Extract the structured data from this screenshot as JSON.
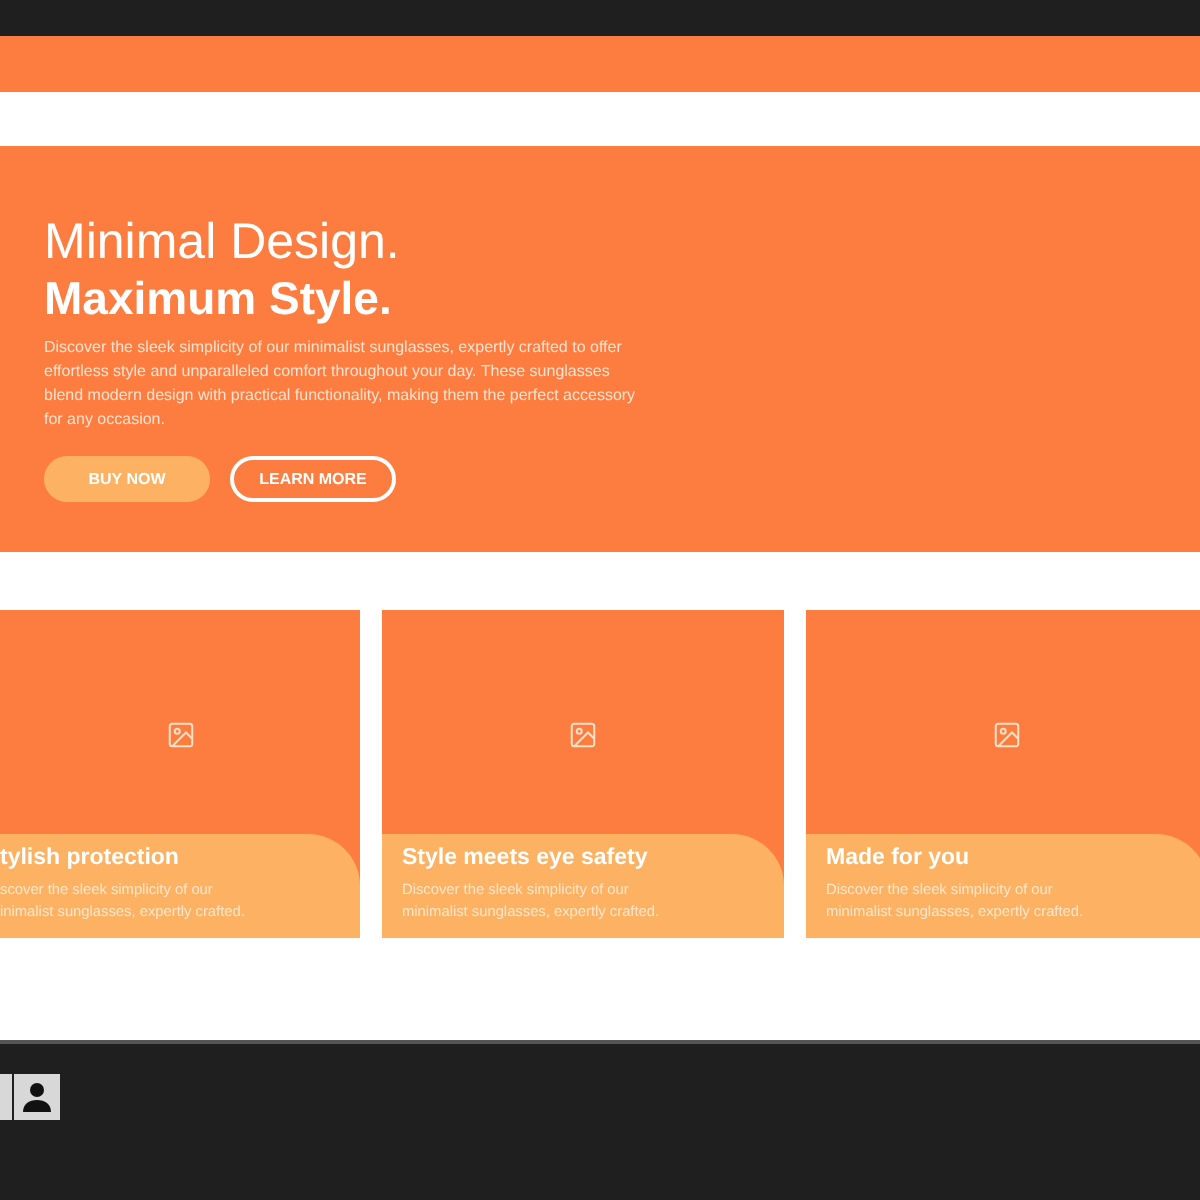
{
  "hero": {
    "title": "Minimal Design.",
    "subtitle": "Maximum Style.",
    "text": "Discover the sleek simplicity of our minimalist sunglasses, expertly crafted to offer effortless style and unparalleled comfort throughout your day. These sunglasses blend modern design with practical functionality, making them the perfect accessory for any occasion.",
    "buttons": [
      {
        "label": "BUY NOW",
        "kind": "filled"
      },
      {
        "label": "LEARN MORE",
        "kind": "outline"
      }
    ]
  },
  "cards": [
    {
      "title": "tylish protection",
      "text": "scover the sleek simplicity of our\ninimalist sunglasses, expertly crafted."
    },
    {
      "title": "Style meets eye safety",
      "text": "Discover the sleek simplicity of our\nminimalist sunglasses, expertly crafted."
    },
    {
      "title": "Made for you",
      "text": "Discover the sleek simplicity of our\nminimalist sunglasses, expertly crafted."
    }
  ]
}
